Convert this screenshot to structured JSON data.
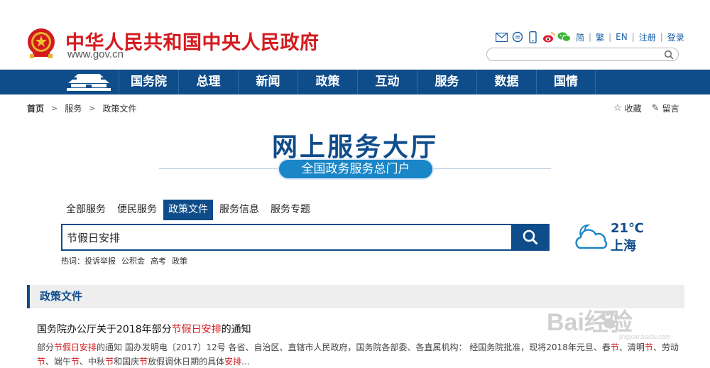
{
  "header": {
    "title": "中华人民共和国中央人民政府",
    "url": "www.gov.cn",
    "tools": [
      "mail-icon",
      "chat-bubble-icon",
      "mobile-icon",
      "weibo-icon",
      "wechat-icon"
    ],
    "lang_links": [
      "简",
      "繁",
      "EN",
      "注册",
      "登录"
    ],
    "search_placeholder": ""
  },
  "nav": {
    "items": [
      "国务院",
      "总理",
      "新闻",
      "政策",
      "互动",
      "服务",
      "数据",
      "国情"
    ]
  },
  "breadcrumb": {
    "home": "首页",
    "level1": "服务",
    "level2": "政策文件"
  },
  "actions": {
    "favorite": "收藏",
    "comment": "留言"
  },
  "hero": {
    "title": "网上服务大厅",
    "subtitle": "全国政务服务总门户"
  },
  "tabs": [
    "全部服务",
    "便民服务",
    "政策文件",
    "服务信息",
    "服务专题"
  ],
  "active_tab": 2,
  "search": {
    "value": "节假日安排"
  },
  "hot": {
    "label": "热词：",
    "items": [
      "投诉举报",
      "公积金",
      "高考",
      "政策"
    ]
  },
  "weather": {
    "temp": "21℃",
    "city": "上海",
    "icon": "partly-cloudy-icon"
  },
  "section": {
    "title": "政策文件"
  },
  "result": {
    "title_before": "国务院办公厅关于2018年部分",
    "title_highlight": "节假日安排",
    "title_after": "的通知",
    "desc_parts": [
      {
        "t": "部分",
        "h": false
      },
      {
        "t": "节假日安排",
        "h": true
      },
      {
        "t": "的通知 国办发明电〔2017〕12号 各省、自治区、直辖市人民政府，国务院各部委、各直属机构： 经国务院批准，现将2018年元旦、春",
        "h": false
      },
      {
        "t": "节",
        "h": true
      },
      {
        "t": "、清明",
        "h": false
      },
      {
        "t": "节",
        "h": true
      },
      {
        "t": "、劳动",
        "h": false
      },
      {
        "t": "节",
        "h": true
      },
      {
        "t": "、端午",
        "h": false
      },
      {
        "t": "节",
        "h": true
      },
      {
        "t": "、中秋",
        "h": false
      },
      {
        "t": "节",
        "h": true
      },
      {
        "t": "和国庆",
        "h": false
      },
      {
        "t": "节",
        "h": true
      },
      {
        "t": "放假调休日期的具体",
        "h": false
      },
      {
        "t": "安排",
        "h": true
      },
      {
        "t": "...",
        "h": false
      }
    ]
  },
  "watermark": {
    "text": "Bai经验",
    "sub": "jingyan.baidu.com"
  },
  "colors": {
    "brand_blue": "#0f4c8a",
    "title_red": "#d31b1f",
    "pill_blue": "#1a86c8"
  }
}
